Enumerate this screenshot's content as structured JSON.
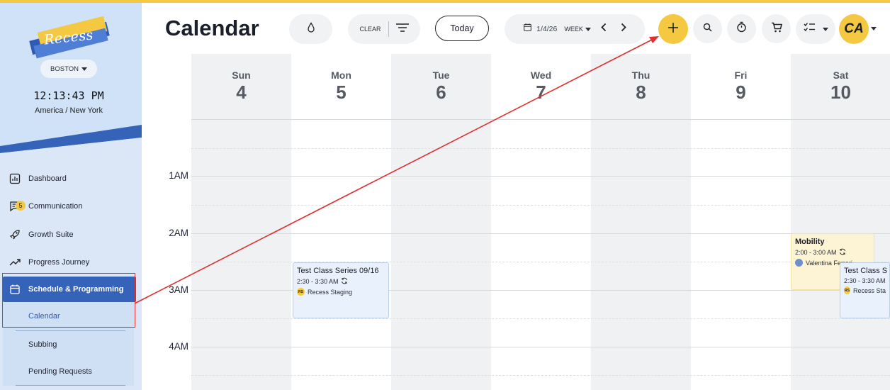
{
  "sidebar": {
    "brand": "Recess",
    "location": "BOSTON",
    "clock": "12:13:43 PM",
    "timezone": "America / New York",
    "nav": [
      {
        "label": "Dashboard",
        "icon": "bar-chart-icon"
      },
      {
        "label": "Communication",
        "icon": "message-icon",
        "badge": "5"
      },
      {
        "label": "Growth Suite",
        "icon": "rocket-icon"
      },
      {
        "label": "Progress Journey",
        "icon": "trend-up-icon"
      },
      {
        "label": "Schedule & Programming",
        "icon": "calendar-icon",
        "active": true
      }
    ],
    "sub_nav": [
      "Calendar",
      "Subbing",
      "Pending Requests"
    ]
  },
  "header": {
    "title": "Calendar",
    "clear_label": "CLEAR",
    "today_label": "Today",
    "date": "1/4/26",
    "view": "WEEK",
    "avatar_initials": "CA"
  },
  "calendar": {
    "days": [
      {
        "name": "Sun",
        "num": "4"
      },
      {
        "name": "Mon",
        "num": "5"
      },
      {
        "name": "Tue",
        "num": "6"
      },
      {
        "name": "Wed",
        "num": "7"
      },
      {
        "name": "Thu",
        "num": "8"
      },
      {
        "name": "Fri",
        "num": "9"
      },
      {
        "name": "Sat",
        "num": "10"
      }
    ],
    "hours": [
      "1AM",
      "2AM",
      "3AM",
      "4AM"
    ],
    "events": [
      {
        "title": "Test Class Series 09/16",
        "time": "2:30 - 3:30 AM",
        "who": "Recess Staging",
        "avatar": "RS"
      },
      {
        "title": "Mobility",
        "time": "2:00 - 3:00 AM",
        "who": "Valentina Ferrari",
        "avatar": ""
      },
      {
        "title": "Test Class S",
        "time": "2:30 - 3:30 AM",
        "who": "Recess Sta",
        "avatar": "RS"
      }
    ]
  },
  "colors": {
    "accent": "#f5c842",
    "primary": "#3563b9",
    "annotation": "#e03030"
  }
}
